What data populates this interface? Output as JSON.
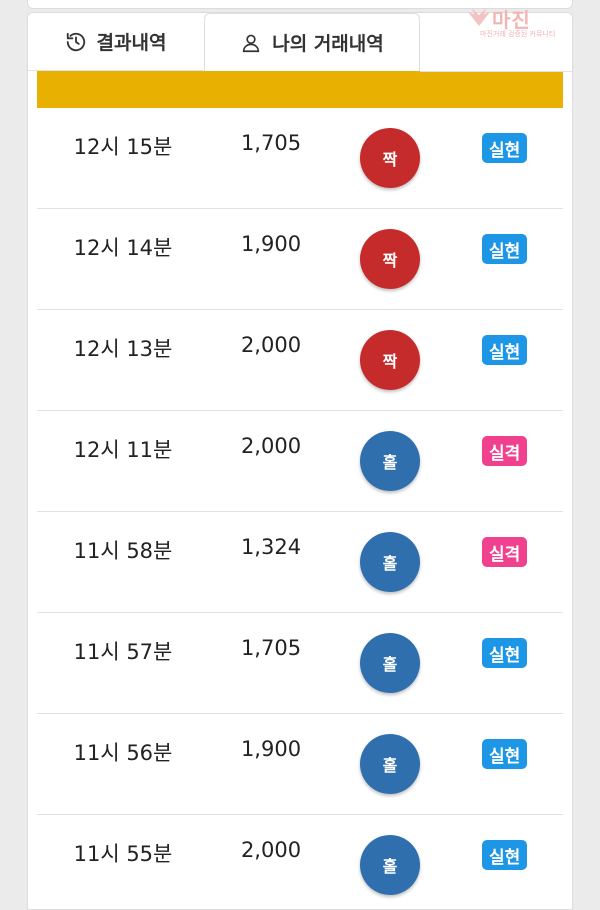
{
  "tabs": [
    {
      "label": "결과내역",
      "icon": "history-icon"
    },
    {
      "label": "나의 거래내역",
      "icon": "user-icon"
    }
  ],
  "watermark": {
    "title": "마진",
    "subtitle": "마진거래 검증된 커뮤니티"
  },
  "colors": {
    "accent_header": "#e8b000",
    "even": "#c62b2b",
    "odd": "#2f6fae",
    "win": "#1e96e6",
    "lose": "#f0418f"
  },
  "rows": [
    {
      "time": "12시 15분",
      "amount": "1,705",
      "result": "짝",
      "status": "실현"
    },
    {
      "time": "12시 14분",
      "amount": "1,900",
      "result": "짝",
      "status": "실현"
    },
    {
      "time": "12시 13분",
      "amount": "2,000",
      "result": "짝",
      "status": "실현"
    },
    {
      "time": "12시 11분",
      "amount": "2,000",
      "result": "홀",
      "status": "실격"
    },
    {
      "time": "11시 58분",
      "amount": "1,324",
      "result": "홀",
      "status": "실격"
    },
    {
      "time": "11시 57분",
      "amount": "1,705",
      "result": "홀",
      "status": "실현"
    },
    {
      "time": "11시 56분",
      "amount": "1,900",
      "result": "홀",
      "status": "실현"
    },
    {
      "time": "11시 55분",
      "amount": "2,000",
      "result": "홀",
      "status": "실현"
    }
  ]
}
